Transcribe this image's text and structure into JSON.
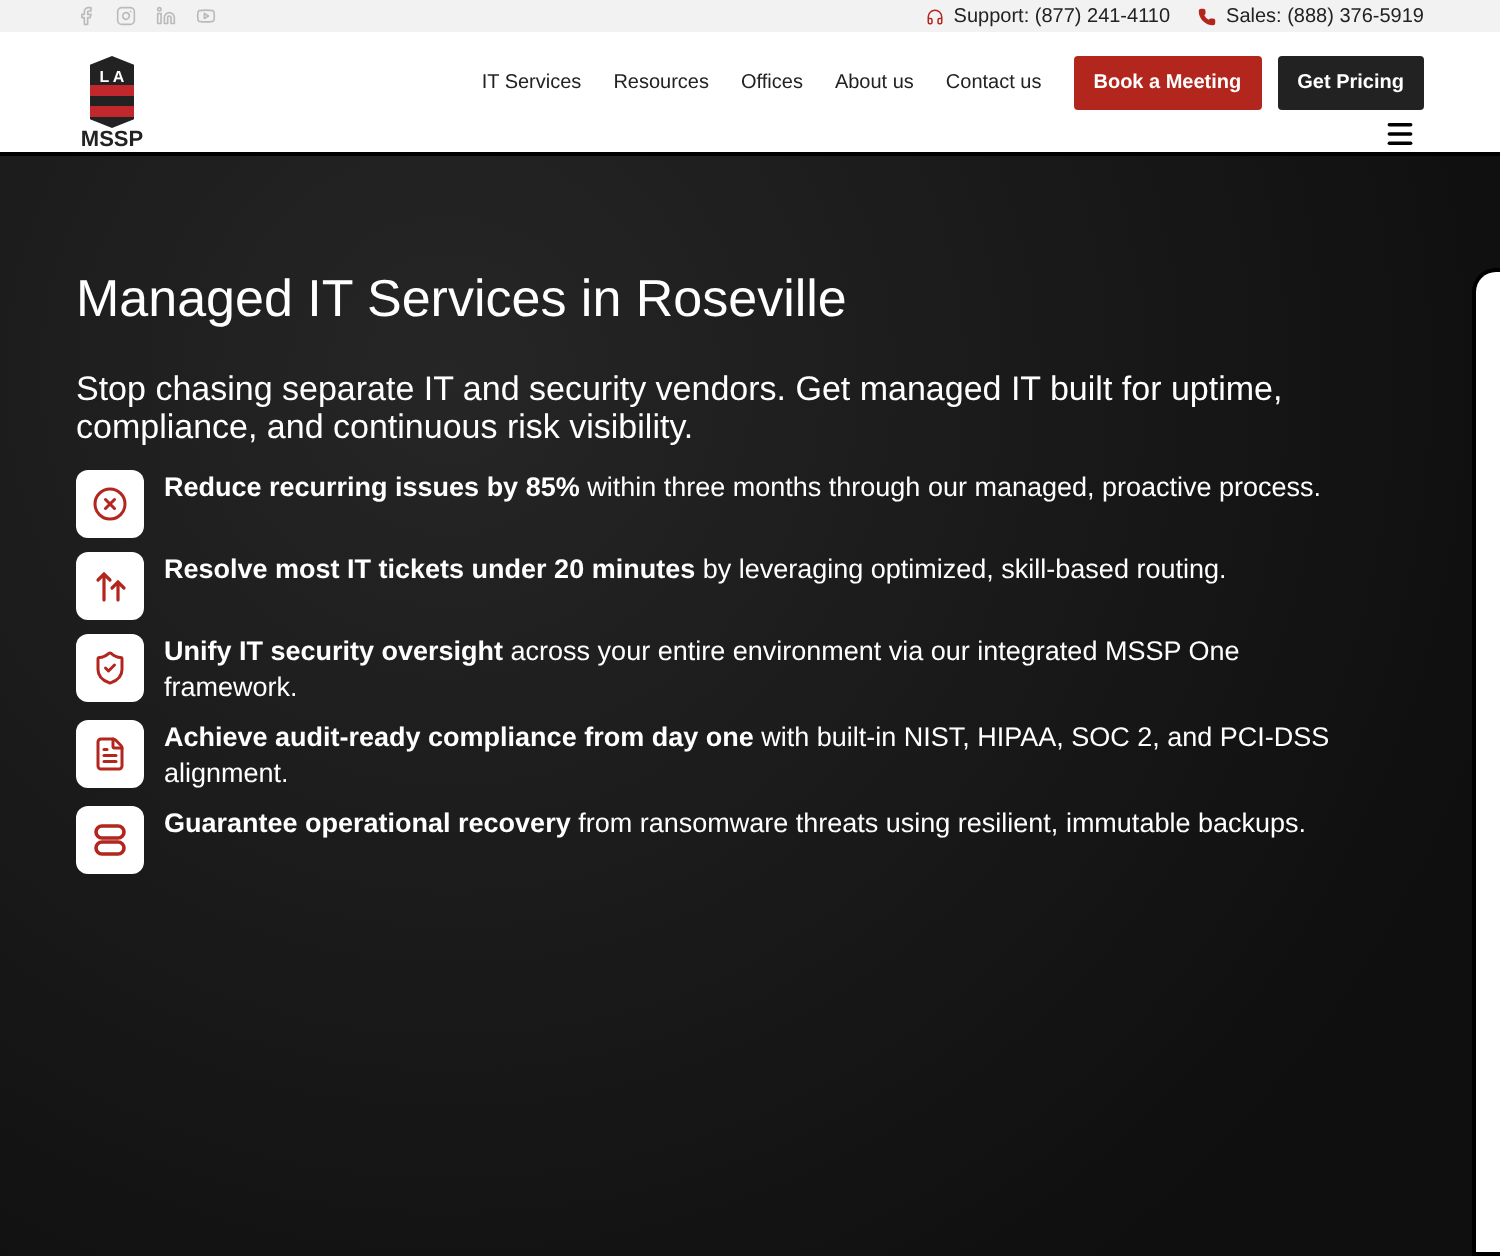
{
  "topbar": {
    "contacts": [
      {
        "kind": "headset",
        "text": "Support: (877) 241-4110"
      },
      {
        "kind": "phone",
        "text": "Sales: (888) 376-5919"
      }
    ]
  },
  "header": {
    "logo": {
      "letters": "L A",
      "name": "MSSP"
    },
    "nav": [
      "IT Services",
      "Resources",
      "Offices",
      "About us",
      "Contact us"
    ],
    "buttons": [
      {
        "label": "Book a Meeting",
        "kind": "primary"
      },
      {
        "label": "Get Pricing",
        "kind": "dark"
      }
    ]
  },
  "hero": {
    "title": "Managed IT Services in Roseville",
    "subtitle": "Stop chasing separate IT and security vendors. Get managed IT built for uptime, compliance, and continuous risk visibility.",
    "features": [
      {
        "text": "**Reduce recurring issues by 85%** within three months through our managed, proactive process."
      },
      {
        "text": "**Resolve most IT tickets under 20 minutes** by leveraging optimized, skill-based routing."
      },
      {
        "text": "**Unify IT security oversight** across your entire environment via our integrated MSSP One framework."
      },
      {
        "text": "**Achieve audit-ready compliance from day one** with built-in NIST, HIPAA, SOC 2, and PCI-DSS alignment."
      },
      {
        "text": "**Guarantee operational recovery** from ransomware threats using resilient, immutable backups."
      }
    ]
  }
}
